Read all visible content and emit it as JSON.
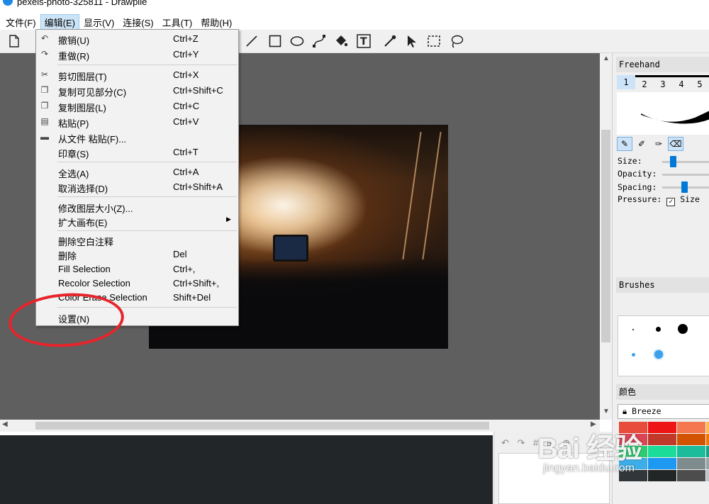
{
  "window": {
    "title": "pexels-photo-325811 - Drawpile"
  },
  "menubar": [
    {
      "label": "文件(F)"
    },
    {
      "label": "编辑(E)"
    },
    {
      "label": "显示(V)"
    },
    {
      "label": "连接(S)"
    },
    {
      "label": "工具(T)"
    },
    {
      "label": "帮助(H)"
    }
  ],
  "edit_menu": {
    "items": [
      {
        "label": "撤销(U)",
        "shortcut": "Ctrl+Z",
        "icon": "undo-icon"
      },
      {
        "label": "重做(R)",
        "shortcut": "Ctrl+Y",
        "icon": "redo-icon"
      },
      {
        "label": "剪切图层(T)",
        "shortcut": "Ctrl+X",
        "icon": "cut-icon"
      },
      {
        "label": "复制可见部分(C)",
        "shortcut": "Ctrl+Shift+C",
        "icon": "copy-icon"
      },
      {
        "label": "复制图层(L)",
        "shortcut": "Ctrl+C",
        "icon": "copy-icon"
      },
      {
        "label": "粘贴(P)",
        "shortcut": "Ctrl+V",
        "icon": "paste-icon"
      },
      {
        "label": "从文件 粘贴(F)...",
        "shortcut": "",
        "icon": "folder-icon"
      },
      {
        "label": "印章(S)",
        "shortcut": "Ctrl+T"
      },
      {
        "label": "全选(A)",
        "shortcut": "Ctrl+A"
      },
      {
        "label": "取消选择(D)",
        "shortcut": "Ctrl+Shift+A"
      },
      {
        "label": "修改图层大小(Z)...",
        "shortcut": ""
      },
      {
        "label": "扩大画布(E)",
        "shortcut": ""
      },
      {
        "label": "删除空白注释",
        "shortcut": ""
      },
      {
        "label": "删除",
        "shortcut": "Del"
      },
      {
        "label": "Fill Selection",
        "shortcut": "Ctrl+,"
      },
      {
        "label": "Recolor Selection",
        "shortcut": "Ctrl+Shift+,"
      },
      {
        "label": "Color Erase Selection",
        "shortcut": "Shift+Del"
      },
      {
        "label": "设置(N)",
        "shortcut": ""
      }
    ]
  },
  "dock": {
    "brush_panel_title": "Freehand",
    "tabs": [
      "1",
      "2",
      "3",
      "4",
      "5"
    ],
    "size_label": "Size:",
    "opacity_label": "Opacity:",
    "spacing_label": "Spacing:",
    "pressure_label": "Pressure:",
    "pressure_size_label": "Size",
    "pressure_size_checked": true,
    "brushes_title": "Brushes",
    "color_title": "颜色",
    "palette_name": "Breeze",
    "swatch_colors": [
      "#e74c3c",
      "#ed1515",
      "#f47750",
      "#fdbc4b",
      "#da4453",
      "#c0392b",
      "#d35400",
      "#f67400",
      "#2ecc71",
      "#1cdc9a",
      "#1abc9c",
      "#16a085",
      "#3daee9",
      "#1d99f3",
      "#7f8c8d",
      "#95a5a6",
      "#31363b",
      "#232627",
      "#4d4d4d",
      "#bdc3c7"
    ]
  },
  "accent_color": "#0078d7",
  "watermark": {
    "main": "Bai  经验",
    "sub": "jingyan.baidu.com"
  }
}
